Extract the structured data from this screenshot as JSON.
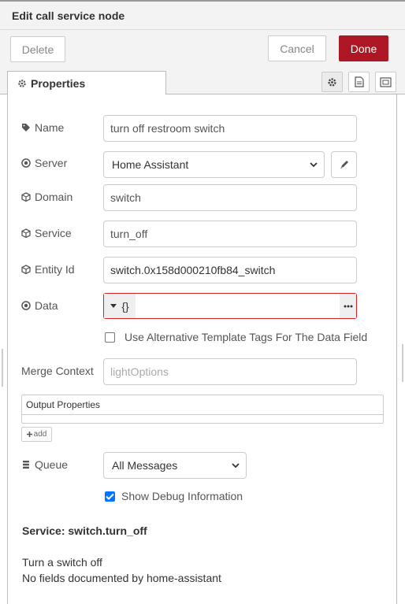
{
  "dialog": {
    "title": "Edit call service node"
  },
  "buttons": {
    "delete": "Delete",
    "cancel": "Cancel",
    "done": "Done"
  },
  "tabs": {
    "properties": "Properties"
  },
  "fields": {
    "name": {
      "label": "Name",
      "value": "turn off restroom switch"
    },
    "server": {
      "label": "Server",
      "value": "Home Assistant"
    },
    "domain": {
      "label": "Domain",
      "value": "switch"
    },
    "service": {
      "label": "Service",
      "value": "turn_off"
    },
    "entity_id": {
      "label": "Entity Id",
      "value": "switch.0x158d000210fb84_switch"
    },
    "data": {
      "label": "Data",
      "type_label": "{}",
      "value": ""
    },
    "alt_template": {
      "label": "Use Alternative Template Tags For The Data Field",
      "checked": false
    },
    "merge_context": {
      "label": "Merge Context",
      "placeholder": "lightOptions"
    },
    "output_properties": {
      "header": "Output Properties",
      "add_label": "add"
    },
    "queue": {
      "label": "Queue",
      "value": "All Messages"
    },
    "debug": {
      "label": "Show Debug Information",
      "checked": true
    }
  },
  "service_info": {
    "title": "Service: switch.turn_off",
    "description": "Turn a switch off",
    "fields_note": "No fields documented by home-assistant"
  },
  "colors": {
    "done": "#ad1625",
    "error_border": "#d62222",
    "checkbox": "#0075ff"
  }
}
